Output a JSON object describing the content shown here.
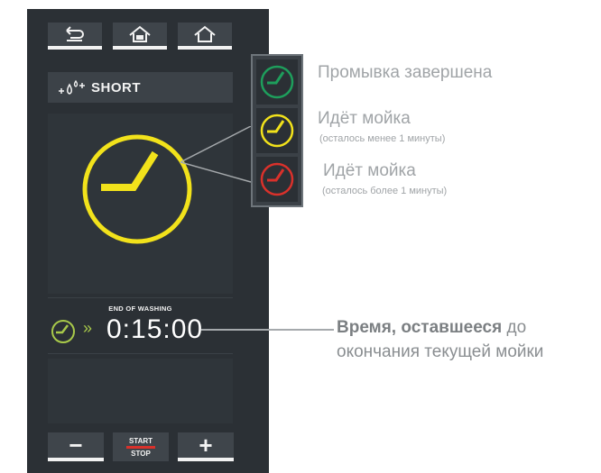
{
  "toolbar": {
    "back_icon": "back-arrow-icon",
    "home_my_icon": "home-my-icon",
    "home_icon": "home-icon"
  },
  "mode": {
    "icon": "water-drops-icon",
    "label": "SHORT"
  },
  "status_clock": {
    "color": "#f2e21b",
    "icon": "clock-icon"
  },
  "end_of_washing": {
    "label": "END OF WASHING",
    "time": "0:15:00",
    "chevron": "»",
    "clock_color": "#a8c94a"
  },
  "bottom_bar": {
    "minus": "−",
    "start_label": "START",
    "stop_label": "STOP",
    "plus": "+"
  },
  "legend": [
    {
      "color": "#1e9e5c",
      "title": "Промывка завершена",
      "note": ""
    },
    {
      "color": "#f2e21b",
      "title": "Идёт  мойка",
      "note": "(осталось менее 1 минуты)"
    },
    {
      "color": "#d9312b",
      "title": "Идёт  мойка",
      "note": "(осталось более 1 минуты)"
    }
  ],
  "callout": {
    "bold": "Время, оставшееся",
    "rest": " до",
    "line2": "окончания текущей мойки"
  }
}
